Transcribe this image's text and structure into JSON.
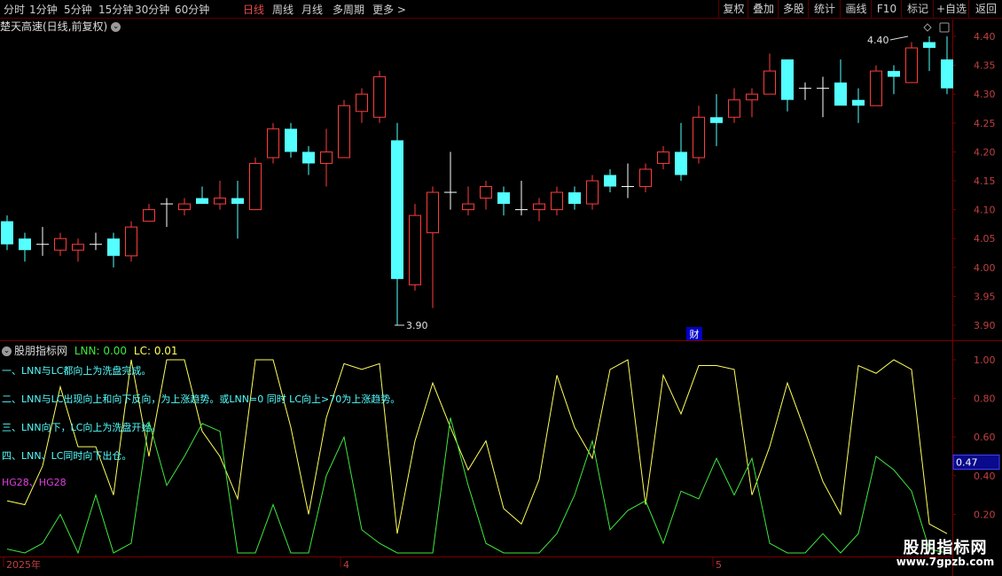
{
  "toolbar": {
    "periods": [
      "分时",
      "1分钟",
      "5分钟",
      "15分钟",
      "30分钟",
      "60分钟",
      "日线",
      "周线",
      "月线",
      "多周期",
      "更多 >"
    ],
    "active_index": 6,
    "right_buttons": [
      "复权",
      "叠加",
      "多股",
      "统计",
      "画线",
      "F10",
      "标记",
      "+自选",
      "返回"
    ]
  },
  "title": {
    "stock": "楚天高速(日线,前复权)",
    "circle_icon": "chevron-down-icon"
  },
  "main_chart": {
    "price_ticks": [
      "4.40",
      "4.35",
      "4.30",
      "4.25",
      "4.20",
      "4.15",
      "4.10",
      "4.05",
      "4.00",
      "3.95",
      "3.90"
    ],
    "high_label": "4.40",
    "low_label": "3.90",
    "event_marker": "财",
    "colors": {
      "up": "#ff3c3c",
      "down": "#54ffff",
      "flat": "#ffffff",
      "grid": "#7a0000"
    }
  },
  "chart_data": {
    "type": "candlestick",
    "candles": [
      {
        "o": 4.08,
        "h": 4.09,
        "l": 4.03,
        "c": 4.04
      },
      {
        "o": 4.05,
        "h": 4.06,
        "l": 4.01,
        "c": 4.03
      },
      {
        "o": 4.04,
        "h": 4.07,
        "l": 4.02,
        "c": 4.04
      },
      {
        "o": 4.03,
        "h": 4.06,
        "l": 4.02,
        "c": 4.05
      },
      {
        "o": 4.03,
        "h": 4.05,
        "l": 4.01,
        "c": 4.04
      },
      {
        "o": 4.04,
        "h": 4.06,
        "l": 4.03,
        "c": 4.04
      },
      {
        "o": 4.05,
        "h": 4.06,
        "l": 4.0,
        "c": 4.02
      },
      {
        "o": 4.02,
        "h": 4.08,
        "l": 4.01,
        "c": 4.07
      },
      {
        "o": 4.08,
        "h": 4.11,
        "l": 4.08,
        "c": 4.1
      },
      {
        "o": 4.11,
        "h": 4.12,
        "l": 4.07,
        "c": 4.11
      },
      {
        "o": 4.1,
        "h": 4.12,
        "l": 4.09,
        "c": 4.11
      },
      {
        "o": 4.12,
        "h": 4.14,
        "l": 4.11,
        "c": 4.11
      },
      {
        "o": 4.11,
        "h": 4.15,
        "l": 4.1,
        "c": 4.12
      },
      {
        "o": 4.12,
        "h": 4.15,
        "l": 4.05,
        "c": 4.11
      },
      {
        "o": 4.1,
        "h": 4.19,
        "l": 4.1,
        "c": 4.18
      },
      {
        "o": 4.19,
        "h": 4.25,
        "l": 4.18,
        "c": 4.24
      },
      {
        "o": 4.24,
        "h": 4.25,
        "l": 4.19,
        "c": 4.2
      },
      {
        "o": 4.2,
        "h": 4.21,
        "l": 4.16,
        "c": 4.18
      },
      {
        "o": 4.18,
        "h": 4.24,
        "l": 4.14,
        "c": 4.2
      },
      {
        "o": 4.19,
        "h": 4.29,
        "l": 4.19,
        "c": 4.28
      },
      {
        "o": 4.27,
        "h": 4.31,
        "l": 4.25,
        "c": 4.3
      },
      {
        "o": 4.26,
        "h": 4.34,
        "l": 4.25,
        "c": 4.33
      },
      {
        "o": 4.22,
        "h": 4.25,
        "l": 3.9,
        "c": 3.98
      },
      {
        "o": 3.97,
        "h": 4.11,
        "l": 3.96,
        "c": 4.09
      },
      {
        "o": 4.06,
        "h": 4.14,
        "l": 3.93,
        "c": 4.13
      },
      {
        "o": 4.13,
        "h": 4.2,
        "l": 4.1,
        "c": 4.13
      },
      {
        "o": 4.1,
        "h": 4.14,
        "l": 4.09,
        "c": 4.11
      },
      {
        "o": 4.12,
        "h": 4.15,
        "l": 4.1,
        "c": 4.14
      },
      {
        "o": 4.13,
        "h": 4.14,
        "l": 4.09,
        "c": 4.11
      },
      {
        "o": 4.1,
        "h": 4.15,
        "l": 4.09,
        "c": 4.1
      },
      {
        "o": 4.1,
        "h": 4.12,
        "l": 4.08,
        "c": 4.11
      },
      {
        "o": 4.1,
        "h": 4.14,
        "l": 4.09,
        "c": 4.13
      },
      {
        "o": 4.13,
        "h": 4.14,
        "l": 4.1,
        "c": 4.11
      },
      {
        "o": 4.11,
        "h": 4.16,
        "l": 4.1,
        "c": 4.15
      },
      {
        "o": 4.16,
        "h": 4.17,
        "l": 4.13,
        "c": 4.14
      },
      {
        "o": 4.14,
        "h": 4.18,
        "l": 4.12,
        "c": 4.14
      },
      {
        "o": 4.14,
        "h": 4.18,
        "l": 4.13,
        "c": 4.17
      },
      {
        "o": 4.18,
        "h": 4.21,
        "l": 4.17,
        "c": 4.2
      },
      {
        "o": 4.2,
        "h": 4.25,
        "l": 4.15,
        "c": 4.16
      },
      {
        "o": 4.19,
        "h": 4.28,
        "l": 4.18,
        "c": 4.26
      },
      {
        "o": 4.26,
        "h": 4.3,
        "l": 4.21,
        "c": 4.25
      },
      {
        "o": 4.26,
        "h": 4.31,
        "l": 4.25,
        "c": 4.29
      },
      {
        "o": 4.29,
        "h": 4.31,
        "l": 4.26,
        "c": 4.3
      },
      {
        "o": 4.3,
        "h": 4.37,
        "l": 4.3,
        "c": 4.34
      },
      {
        "o": 4.36,
        "h": 4.36,
        "l": 4.27,
        "c": 4.29
      },
      {
        "o": 4.31,
        "h": 4.32,
        "l": 4.29,
        "c": 4.31
      },
      {
        "o": 4.31,
        "h": 4.33,
        "l": 4.26,
        "c": 4.31
      },
      {
        "o": 4.32,
        "h": 4.36,
        "l": 4.29,
        "c": 4.28
      },
      {
        "o": 4.29,
        "h": 4.31,
        "l": 4.25,
        "c": 4.28
      },
      {
        "o": 4.28,
        "h": 4.35,
        "l": 4.28,
        "c": 4.34
      },
      {
        "o": 4.34,
        "h": 4.35,
        "l": 4.3,
        "c": 4.33
      },
      {
        "o": 4.32,
        "h": 4.39,
        "l": 4.32,
        "c": 4.38
      },
      {
        "o": 4.39,
        "h": 4.4,
        "l": 4.34,
        "c": 4.38
      },
      {
        "o": 4.36,
        "h": 4.4,
        "l": 4.3,
        "c": 4.31
      }
    ],
    "x_labels": [
      {
        "label": "2025年",
        "index": 0
      },
      {
        "label": "4",
        "index": 19
      },
      {
        "label": "5",
        "index": 40
      }
    ],
    "ylim": [
      3.88,
      4.42
    ]
  },
  "indicator": {
    "name": "股朋指标网",
    "lnn_label": "LNN: 0.00",
    "lc_label": "LC: 0.01",
    "notes": [
      "一、LNN与LC都向上为洗盘完成。",
      "二、LNN与LC出现向上和向下反向，为上涨趋势。或LNN=0 同时 LC向上>70为上涨趋势。",
      "三、LNN向下，LC向上为洗盘开始。",
      "四、LNN、LC同时向下出仓。"
    ],
    "hg_label": "HG28、HG28",
    "ticks": [
      "1.00",
      "0.80",
      "0.60",
      "0.40",
      "0.20"
    ],
    "current_value": "0.47",
    "lc_values": [
      0.27,
      0.25,
      0.45,
      0.86,
      0.55,
      0.55,
      0.3,
      1.0,
      0.5,
      1.0,
      1.0,
      0.63,
      0.5,
      0.28,
      1.0,
      1.0,
      0.65,
      0.2,
      0.7,
      0.98,
      0.95,
      0.98,
      0.1,
      0.58,
      0.88,
      0.65,
      0.43,
      0.58,
      0.23,
      0.15,
      0.38,
      0.92,
      0.65,
      0.49,
      0.95,
      1.0,
      0.25,
      0.92,
      0.72,
      0.97,
      0.97,
      0.95,
      0.3,
      0.55,
      0.88,
      0.63,
      0.37,
      0.2,
      0.97,
      0.93,
      1.0,
      0.95,
      0.15,
      0.1
    ],
    "lnn_values": [
      0.02,
      0.0,
      0.05,
      0.2,
      0.0,
      0.3,
      0.0,
      0.05,
      0.68,
      0.35,
      0.5,
      0.67,
      0.63,
      0.0,
      0.0,
      0.25,
      0.0,
      0.0,
      0.4,
      0.6,
      0.12,
      0.05,
      0.0,
      0.0,
      0.0,
      0.7,
      0.35,
      0.05,
      0.0,
      0.0,
      0.0,
      0.1,
      0.3,
      0.58,
      0.12,
      0.22,
      0.27,
      0.05,
      0.32,
      0.28,
      0.49,
      0.3,
      0.49,
      0.05,
      0.0,
      0.0,
      0.1,
      0.0,
      0.1,
      0.5,
      0.43,
      0.32,
      0.02,
      0.0
    ]
  },
  "watermark": {
    "title": "股朋指标网",
    "url": "www.7gpzb.com"
  }
}
